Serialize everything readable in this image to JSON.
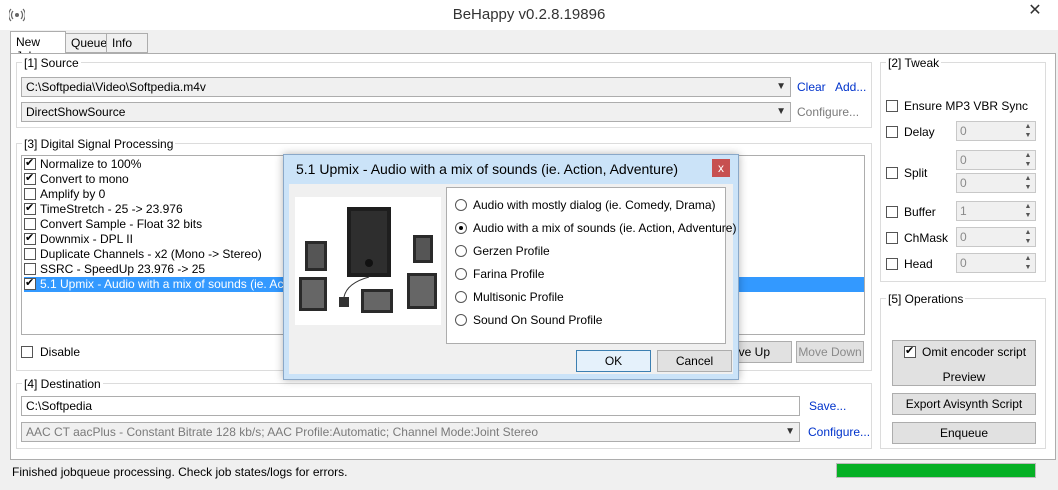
{
  "window": {
    "title": "BeHappy v0.2.8.19896",
    "close_glyph": "✕"
  },
  "tabs": [
    {
      "label": "New Job",
      "active": true
    },
    {
      "label": "Queue",
      "active": false
    },
    {
      "label": "Info",
      "active": false
    }
  ],
  "source": {
    "label": "[1] Source",
    "file_path": "C:\\Softpedia\\Video\\Softpedia.m4v",
    "clear_link": "Clear",
    "add_link": "Add...",
    "decoder": "DirectShowSource",
    "configure_link": "Configure..."
  },
  "dsp": {
    "label": "[3] Digital Signal Processing",
    "items": [
      {
        "label": "Normalize to 100%",
        "checked": true,
        "selected": false
      },
      {
        "label": "Convert to mono",
        "checked": true,
        "selected": false
      },
      {
        "label": "Amplify by 0",
        "checked": false,
        "selected": false
      },
      {
        "label": "TimeStretch - 25 -> 23.976",
        "checked": true,
        "selected": false
      },
      {
        "label": "Convert Sample - Float 32 bits",
        "checked": false,
        "selected": false
      },
      {
        "label": "Downmix - DPL II",
        "checked": true,
        "selected": false
      },
      {
        "label": "Duplicate Channels - x2 (Mono -> Stereo)",
        "checked": false,
        "selected": false
      },
      {
        "label": "SSRC - SpeedUp 23.976 -> 25",
        "checked": false,
        "selected": false
      },
      {
        "label": "5.1 Upmix - Audio with a mix of sounds (ie. Action, Adventure)",
        "checked": true,
        "selected": true
      }
    ],
    "disable_label": "Disable",
    "move_up": "Move Up",
    "move_down": "Move Down"
  },
  "destination": {
    "label": "[4] Destination",
    "path": "C:\\Softpedia",
    "save_link": "Save...",
    "encoder": "AAC CT aacPlus - Constant Bitrate 128 kb/s; AAC Profile:Automatic; Channel Mode:Joint Stereo",
    "configure_link": "Configure..."
  },
  "tweak": {
    "label": "[2] Tweak",
    "mp3_vbr": "Ensure MP3 VBR Sync",
    "delay_label": "Delay",
    "delay_value": "0",
    "split_label": "Split",
    "split_value1": "0",
    "split_value2": "0",
    "buffer_label": "Buffer",
    "buffer_value": "1",
    "chmask_label": "ChMask",
    "chmask_value": "0",
    "head_label": "Head",
    "head_value": "0"
  },
  "operations": {
    "label": "[5] Operations",
    "omit_script": "Omit encoder script",
    "preview": "Preview",
    "export": "Export Avisynth Script",
    "enqueue": "Enqueue"
  },
  "status": {
    "text": "Finished jobqueue processing. Check job states/logs for errors.",
    "progress": 1.0
  },
  "dialog": {
    "title": "5.1 Upmix - Audio with a mix of sounds (ie. Action, Adventure)",
    "close_glyph": "x",
    "options": [
      {
        "label": "Audio with mostly dialog (ie. Comedy, Drama)",
        "checked": false
      },
      {
        "label": "Audio with a mix of sounds (ie. Action, Adventure)",
        "checked": true
      },
      {
        "label": "Gerzen Profile",
        "checked": false
      },
      {
        "label": "Farina Profile",
        "checked": false
      },
      {
        "label": "Multisonic Profile",
        "checked": false
      },
      {
        "label": "Sound On Sound Profile",
        "checked": false
      }
    ],
    "ok": "OK",
    "cancel": "Cancel"
  }
}
